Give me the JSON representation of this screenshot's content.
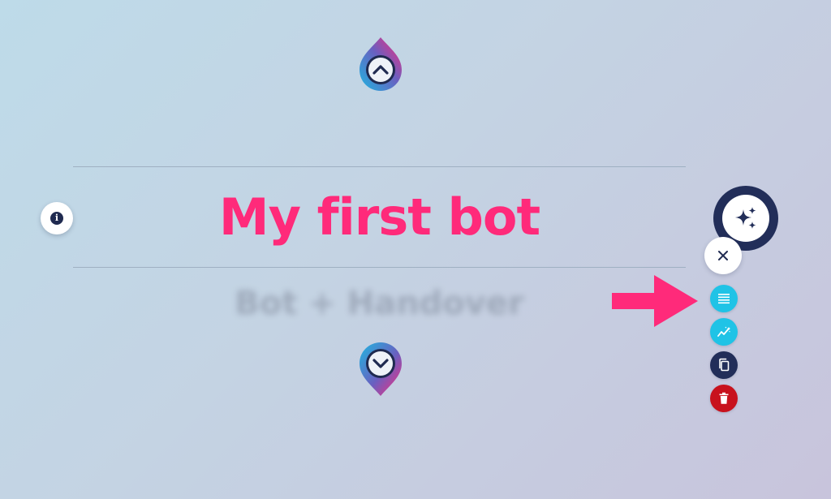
{
  "bot": {
    "title": "My first bot",
    "subtitle": "Bot + Handover"
  },
  "icons": {
    "nav_up": "chevron-up-pin-icon",
    "nav_down": "chevron-down-pin-icon",
    "info": "info-icon",
    "ai": "sparkles-icon",
    "close": "close-icon",
    "menu": "list-lines-icon",
    "analytics": "trend-chart-icon",
    "copy": "copy-icon",
    "delete": "trash-icon",
    "pointer": "right-arrow-icon"
  },
  "info_glyph": "i",
  "colors": {
    "title": "#ff2a7a",
    "navy": "#222e59",
    "cyan": "#1fc3e6",
    "red": "#c8121d",
    "arrow": "#ff2a7a"
  }
}
